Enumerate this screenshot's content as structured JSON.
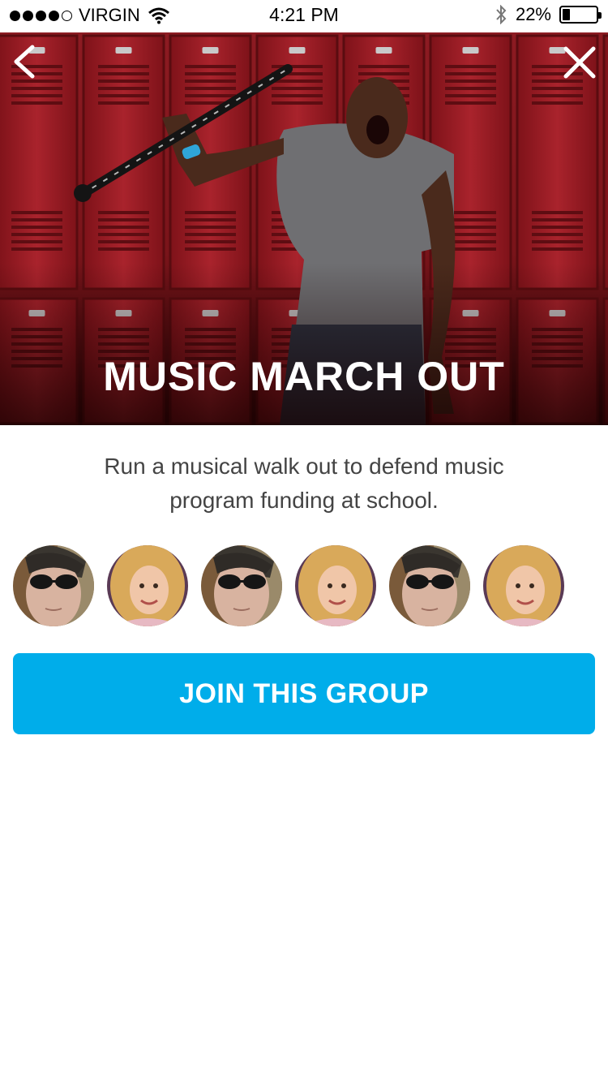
{
  "status_bar": {
    "carrier": "VIRGIN",
    "signal_bars_filled": 4,
    "signal_bars_total": 5,
    "time": "4:21 PM",
    "battery_percent": "22%",
    "battery_level": 0.22,
    "icons": [
      "wifi-icon",
      "bluetooth-icon",
      "battery-icon"
    ]
  },
  "hero": {
    "title": "MUSIC MARCH OUT",
    "back_icon": "chevron-left-icon",
    "close_icon": "close-icon"
  },
  "description": "Run a musical walk out to defend music program funding at school.",
  "members": [
    {
      "kind": "man-sunglasses"
    },
    {
      "kind": "woman-blonde"
    },
    {
      "kind": "man-sunglasses"
    },
    {
      "kind": "woman-blonde"
    },
    {
      "kind": "man-sunglasses"
    },
    {
      "kind": "woman-blonde"
    }
  ],
  "join_button": {
    "label": "JOIN THIS GROUP",
    "color": "#00adea"
  }
}
